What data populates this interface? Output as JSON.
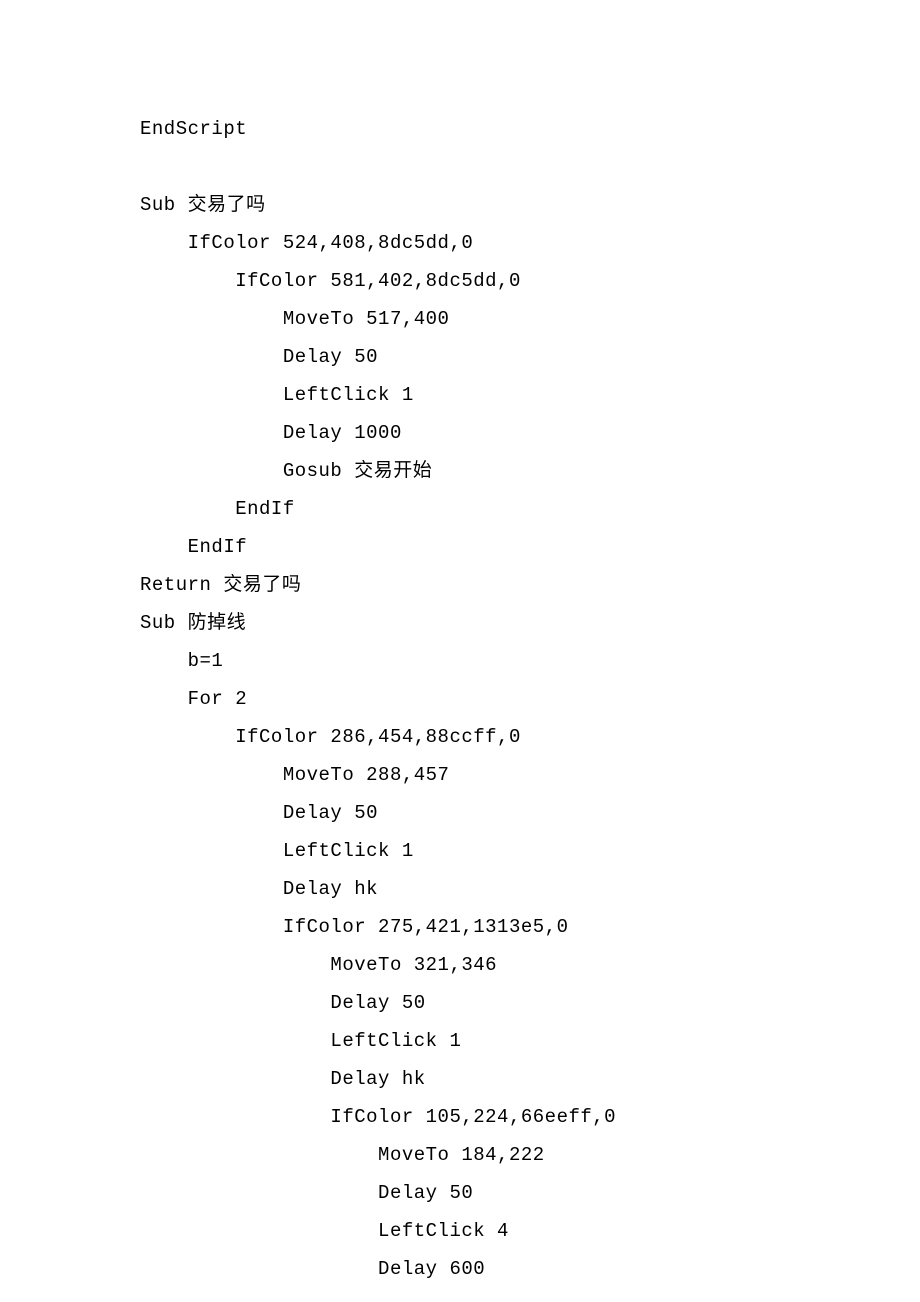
{
  "lines": [
    {
      "indent": 0,
      "text": "EndScript"
    },
    {
      "indent": 0,
      "text": ""
    },
    {
      "indent": 0,
      "text": "Sub 交易了吗"
    },
    {
      "indent": 1,
      "text": "IfColor 524,408,8dc5dd,0"
    },
    {
      "indent": 2,
      "text": "IfColor 581,402,8dc5dd,0"
    },
    {
      "indent": 3,
      "text": "MoveTo 517,400"
    },
    {
      "indent": 3,
      "text": "Delay 50"
    },
    {
      "indent": 3,
      "text": "LeftClick 1"
    },
    {
      "indent": 3,
      "text": "Delay 1000"
    },
    {
      "indent": 3,
      "text": "Gosub 交易开始"
    },
    {
      "indent": 2,
      "text": "EndIf"
    },
    {
      "indent": 1,
      "text": "EndIf"
    },
    {
      "indent": 0,
      "text": "Return 交易了吗"
    },
    {
      "indent": 0,
      "text": "Sub 防掉线"
    },
    {
      "indent": 1,
      "text": "b=1"
    },
    {
      "indent": 1,
      "text": "For 2"
    },
    {
      "indent": 2,
      "text": "IfColor 286,454,88ccff,0"
    },
    {
      "indent": 3,
      "text": "MoveTo 288,457"
    },
    {
      "indent": 3,
      "text": "Delay 50"
    },
    {
      "indent": 3,
      "text": "LeftClick 1"
    },
    {
      "indent": 3,
      "text": "Delay hk"
    },
    {
      "indent": 3,
      "text": "IfColor 275,421,1313e5,0"
    },
    {
      "indent": 4,
      "text": "MoveTo 321,346"
    },
    {
      "indent": 4,
      "text": "Delay 50"
    },
    {
      "indent": 4,
      "text": "LeftClick 1"
    },
    {
      "indent": 4,
      "text": "Delay hk"
    },
    {
      "indent": 4,
      "text": "IfColor 105,224,66eeff,0"
    },
    {
      "indent": 5,
      "text": "MoveTo 184,222"
    },
    {
      "indent": 5,
      "text": "Delay 50"
    },
    {
      "indent": 5,
      "text": "LeftClick 4"
    },
    {
      "indent": 5,
      "text": "Delay 600"
    }
  ],
  "indentUnit": "    "
}
